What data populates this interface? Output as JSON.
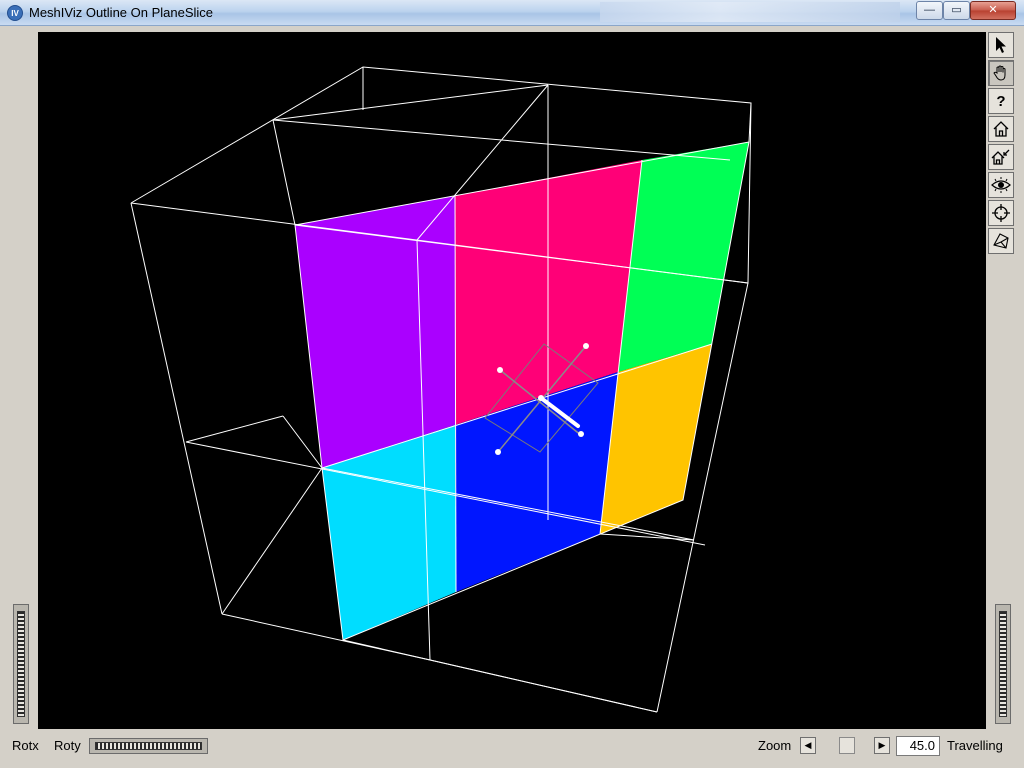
{
  "window": {
    "title": "MeshIViz Outline On PlaneSlice",
    "app_icon_text": "IV",
    "min_glyph": "—",
    "max_glyph": "▭",
    "close_glyph": "✕"
  },
  "toolbar": {
    "buttons": [
      {
        "name": "select-arrow",
        "icon": "arrow-cursor-icon"
      },
      {
        "name": "view-hand",
        "icon": "hand-icon",
        "active": true
      },
      {
        "name": "help",
        "icon": "question-mark-icon",
        "label": "?"
      },
      {
        "name": "home",
        "icon": "home-icon"
      },
      {
        "name": "set-home",
        "icon": "set-home-icon"
      },
      {
        "name": "view-all",
        "icon": "eye-icon"
      },
      {
        "name": "seek",
        "icon": "crosshair-icon"
      },
      {
        "name": "projection",
        "icon": "perspective-box-icon"
      }
    ]
  },
  "bottom": {
    "rotx_label": "Rotx",
    "roty_label": "Roty",
    "zoom_label": "Zoom",
    "zoom_value": "45.0",
    "dolly_label": "Travelling"
  },
  "scene": {
    "background": "#000000",
    "outline_color": "#ffffff",
    "slice_colors": {
      "purple": "#aa00ff",
      "magenta": "#ff0077",
      "green": "#00ff55",
      "cyan": "#00ddff",
      "blue": "#0016ff",
      "orange": "#ffc400"
    }
  }
}
